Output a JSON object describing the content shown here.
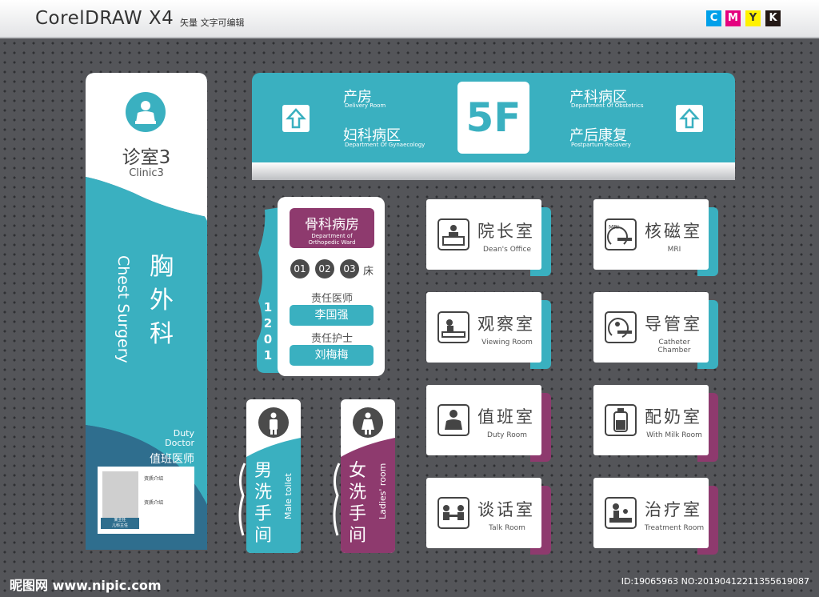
{
  "app": {
    "title": "CorelDRAW X4",
    "subtitle": "矢量 文字可编辑"
  },
  "cmyk": [
    {
      "letter": "C",
      "color": "#00a0e9"
    },
    {
      "letter": "M",
      "color": "#e4007f"
    },
    {
      "letter": "Y",
      "color": "#fff100"
    },
    {
      "letter": "K",
      "color": "#231815"
    }
  ],
  "colors": {
    "teal": "#3ab0c0",
    "purple": "#8e3a6e",
    "dark": "#4b4b4b",
    "navy": "#2f6e8e"
  },
  "clinic_sign": {
    "title": "诊室3",
    "title_en": "Clinic3",
    "dept_cn": "胸外科",
    "dept_en": "Chest Surgery",
    "duty_en_1": "Duty",
    "duty_en_2": "Doctor",
    "duty_cn": "值班医师",
    "info_1": "资质介绍",
    "info_2": "资质介绍",
    "badge_1": "某主任",
    "badge_2": "儿科主任"
  },
  "floor_sign": {
    "floor": "5F",
    "left_items": [
      {
        "cn": "产房",
        "en": "Delivery Room"
      },
      {
        "cn": "妇科病区",
        "en": "Department Of Gynaecology"
      }
    ],
    "right_items": [
      {
        "cn": "产科病区",
        "en": "Department Of Obstetrics"
      },
      {
        "cn": "产后康复",
        "en": "Postpartum Recovery"
      }
    ]
  },
  "ward_sign": {
    "title_cn": "骨科病房",
    "title_en_1": "Department of",
    "title_en_2": "Orthopedic Ward",
    "beds": [
      "01",
      "02",
      "03"
    ],
    "bed_label": "床",
    "doctor_label": "责任医师",
    "doctor_name": "李国强",
    "nurse_label": "责任护士",
    "nurse_name": "刘梅梅",
    "room_no": [
      "1",
      "2",
      "0",
      "1"
    ]
  },
  "toilets": {
    "male": {
      "cn": [
        "男",
        "洗",
        "手",
        "间"
      ],
      "en": "Male toilet"
    },
    "female": {
      "cn": [
        "女",
        "洗",
        "手",
        "间"
      ],
      "en": "Ladies' room"
    }
  },
  "rooms": [
    {
      "cn": "院长室",
      "en": "Dean's Office",
      "icon": "desk-icon"
    },
    {
      "cn": "核磁室",
      "en": "MRI",
      "icon": "mri-icon",
      "icon_label": "MRI"
    },
    {
      "cn": "观察室",
      "en": "Viewing Room",
      "icon": "bed-icon"
    },
    {
      "cn": "导管室",
      "en": "Catheter Chamber",
      "icon": "catheter-icon"
    },
    {
      "cn": "值班室",
      "en": "Duty Room",
      "icon": "staff-icon"
    },
    {
      "cn": "配奶室",
      "en": "With Milk Room",
      "icon": "bottle-icon"
    },
    {
      "cn": "谈话室",
      "en": "Talk Room",
      "icon": "talk-icon"
    },
    {
      "cn": "治疗室",
      "en": "Treatment Room",
      "icon": "treatment-icon"
    }
  ],
  "footer": {
    "left": "昵图网 www.nipic.com",
    "right": "ID:19065963 NO:20190412211355619087"
  }
}
